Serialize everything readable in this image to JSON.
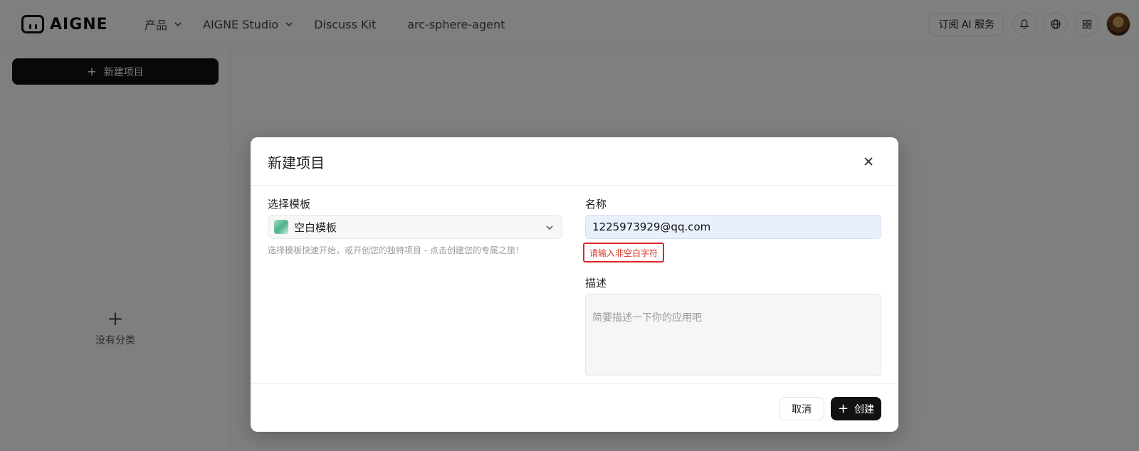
{
  "header": {
    "logo_text": "AIGNE",
    "nav": [
      {
        "label": "产品",
        "has_dropdown": true
      },
      {
        "label": "AIGNE Studio",
        "has_dropdown": true
      },
      {
        "label": "Discuss Kit",
        "has_dropdown": false
      },
      {
        "label": "arc-sphere-agent",
        "has_dropdown": false
      }
    ],
    "subscribe_label": "订阅 AI 服务",
    "icons": [
      "bell-icon",
      "globe-icon",
      "apps-grid-icon"
    ]
  },
  "sidebar": {
    "new_project_label": "新建项目",
    "empty_category_label": "没有分类"
  },
  "modal": {
    "title": "新建项目",
    "template": {
      "label": "选择模板",
      "value": "空白模板",
      "help": "选择模板快速开始，或开创您的独特项目 - 点击创建您的专属之旅！"
    },
    "name": {
      "label": "名称",
      "value": "1225973929@qq.com",
      "error": "请输入非空白字符"
    },
    "description": {
      "label": "描述",
      "placeholder": "简要描述一下你的应用吧",
      "value": ""
    },
    "cancel_label": "取消",
    "create_label": "创建"
  },
  "colors": {
    "primary": "#111111",
    "error": "#e02424",
    "input_autofill_bg": "#e8f0fe"
  }
}
